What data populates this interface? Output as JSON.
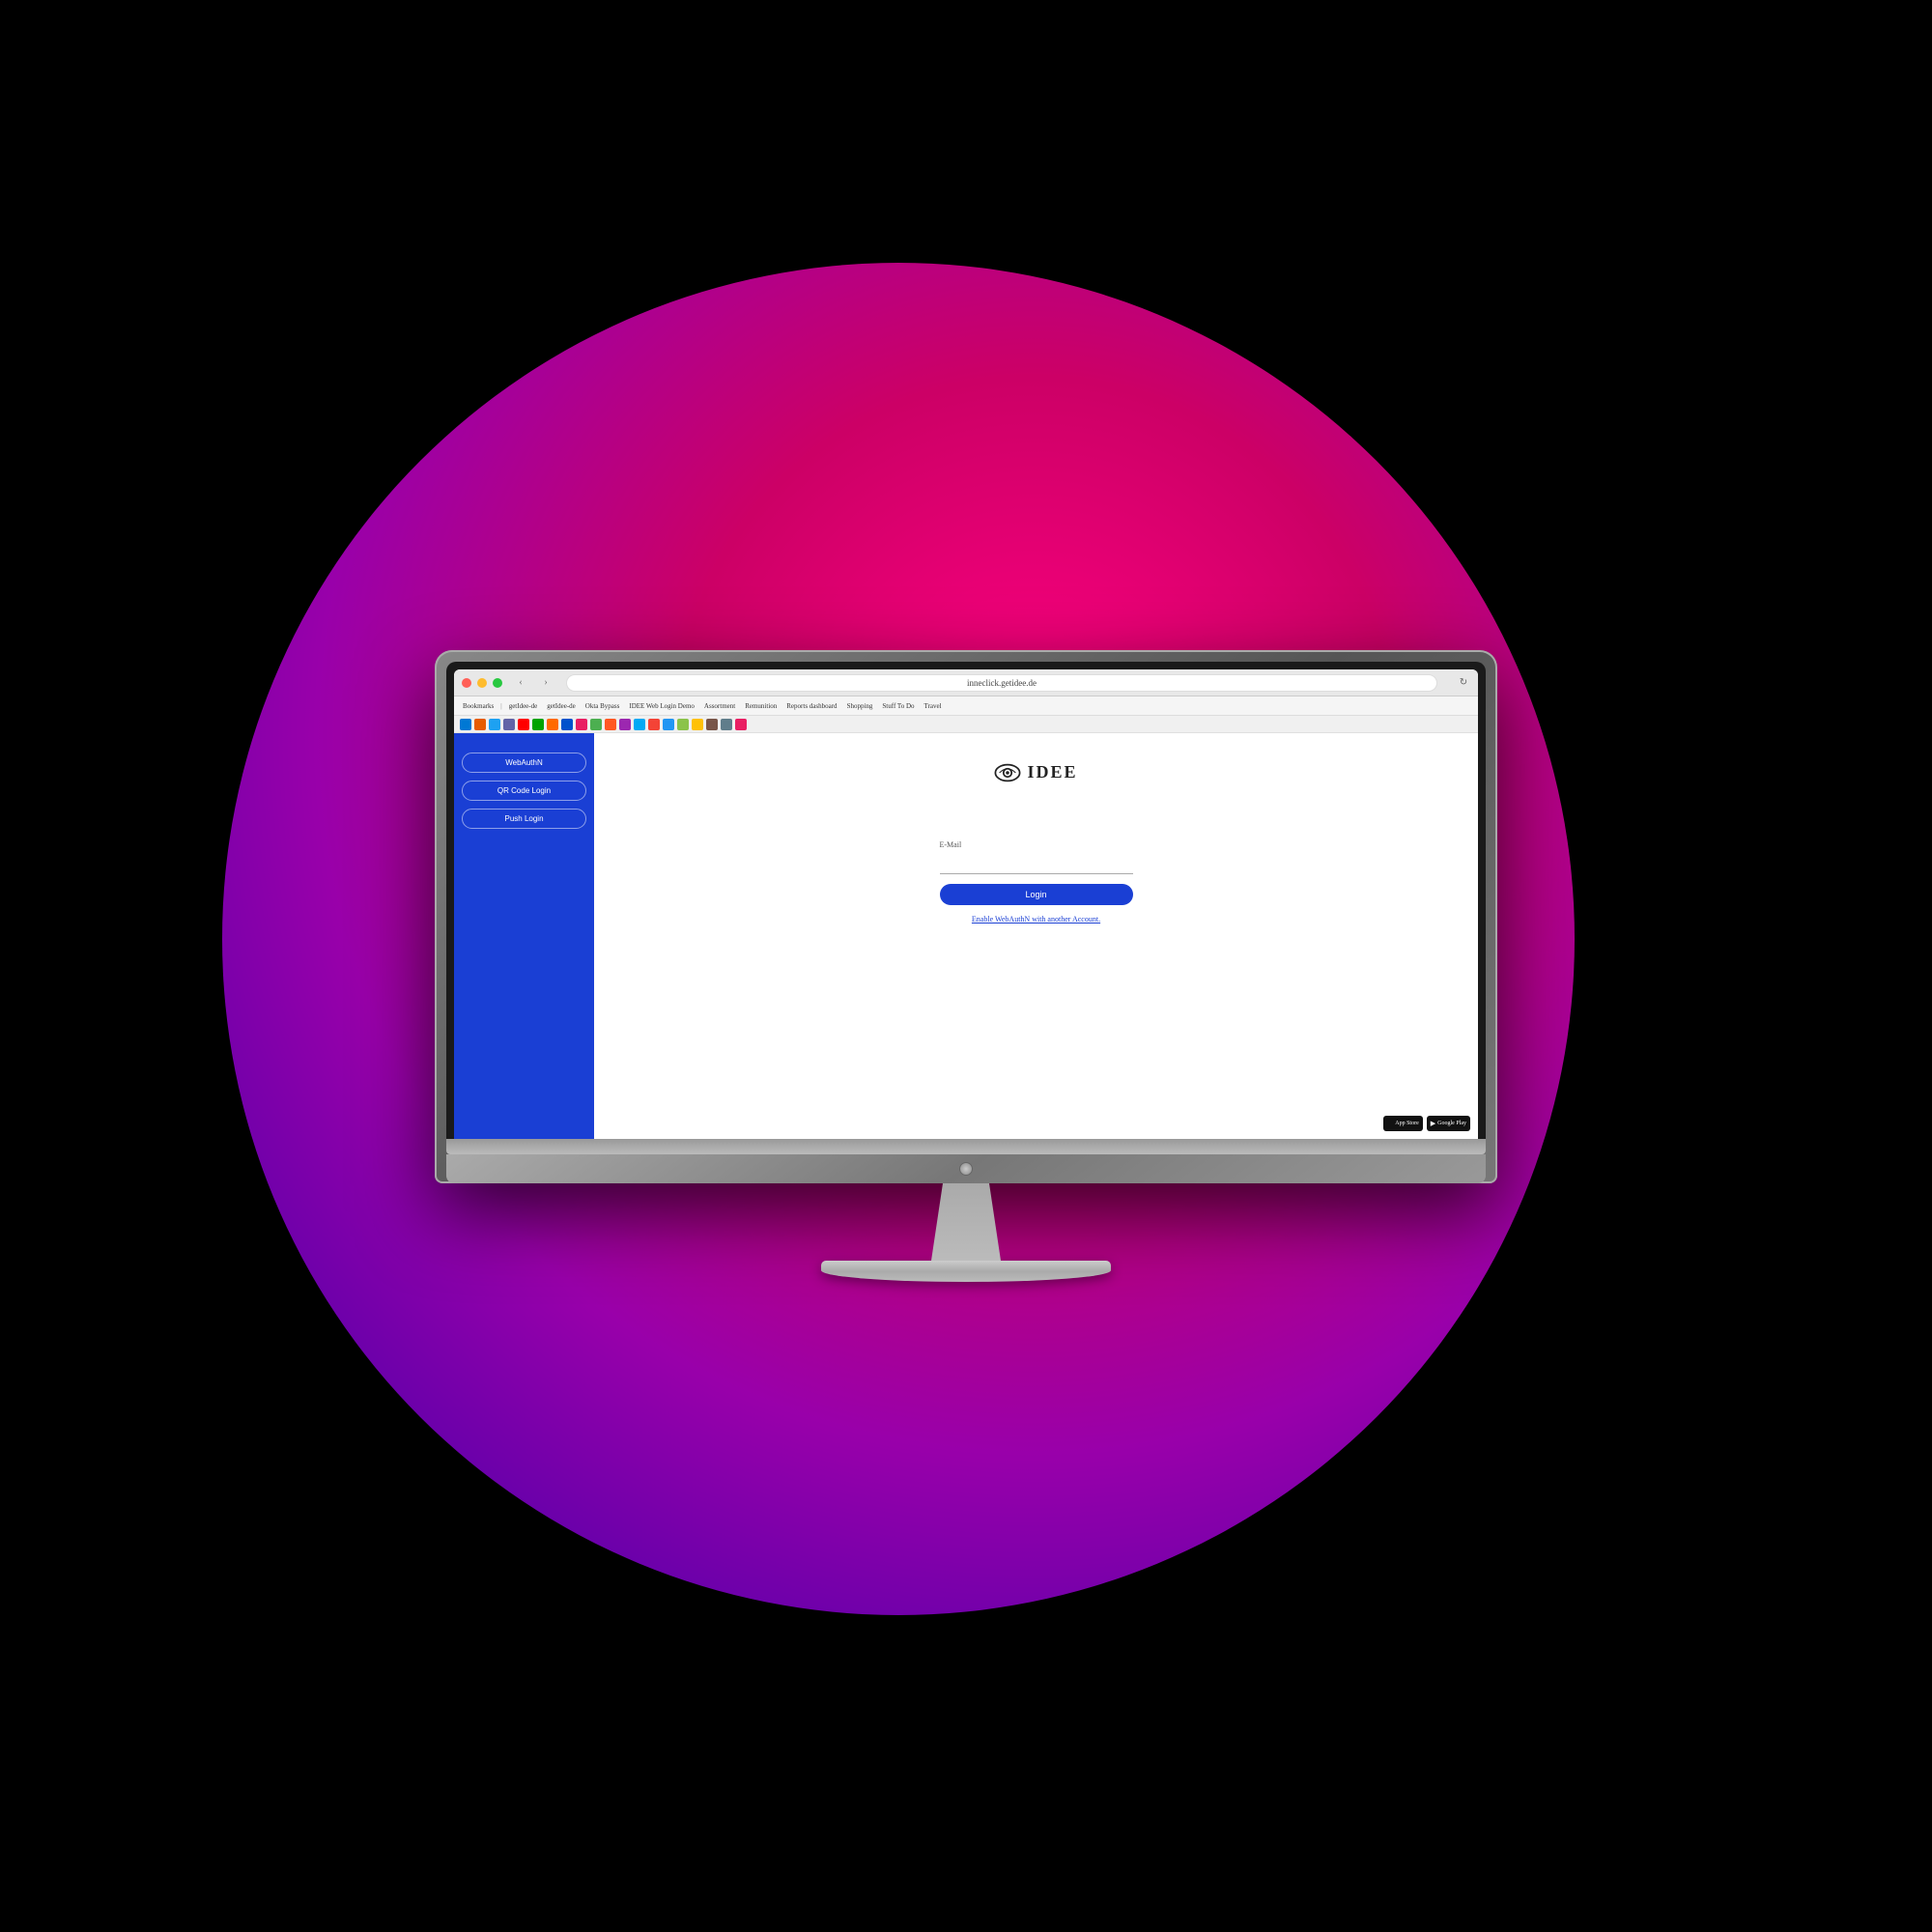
{
  "background": {
    "circle_gradient": "radial from pink to dark purple"
  },
  "browser": {
    "url": "inneclick.getidee.de",
    "window_buttons": [
      "close",
      "minimize",
      "maximize"
    ],
    "bookmarks": [
      "Bookmarks",
      "getIdee-de",
      "getIdee-de",
      "Okta Bypass",
      "IDEE Web Login Demo",
      "Assortment",
      "Remunition",
      "Reports dashboard",
      "Shopping",
      "Stuff To Do",
      "Travel"
    ]
  },
  "sidebar": {
    "background_color": "#1a3fd4",
    "buttons": [
      {
        "label": "WebAuthN",
        "id": "webauthn-btn"
      },
      {
        "label": "QR Code Login",
        "id": "qr-code-btn"
      },
      {
        "label": "Push Login",
        "id": "push-login-btn"
      }
    ]
  },
  "main": {
    "logo": {
      "text": "IDEE",
      "icon_name": "eye-icon"
    },
    "form": {
      "email_label": "E-Mail",
      "email_placeholder": "",
      "login_button_label": "Login",
      "webauthn_link": "Enable WebAuthN with another Account."
    },
    "footer": {
      "app_store_label": "App Store",
      "google_play_label": "Google Play"
    }
  }
}
